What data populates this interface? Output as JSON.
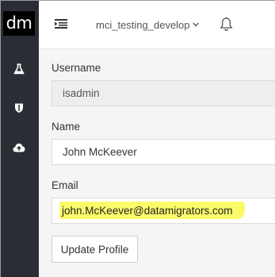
{
  "app": {
    "logo_text": "dm"
  },
  "sidebar": {
    "items": [
      {
        "icon": "flask-icon"
      },
      {
        "icon": "shield-icon"
      },
      {
        "icon": "cloud-upload-icon"
      }
    ]
  },
  "header": {
    "menu_icon": "menu-toggle-icon",
    "database": "mci_testing_develop",
    "notification_icon": "bell-icon"
  },
  "form": {
    "username_label": "Username",
    "username_value": "isadmin",
    "name_label": "Name",
    "name_value": "John McKeever",
    "email_label": "Email",
    "email_value": "john.McKeever@datamigrators.com",
    "submit_label": "Update Profile"
  },
  "colors": {
    "sidebar": "#2a2d33",
    "highlight": "#fbfb6a",
    "logo_bg": "#000000"
  }
}
